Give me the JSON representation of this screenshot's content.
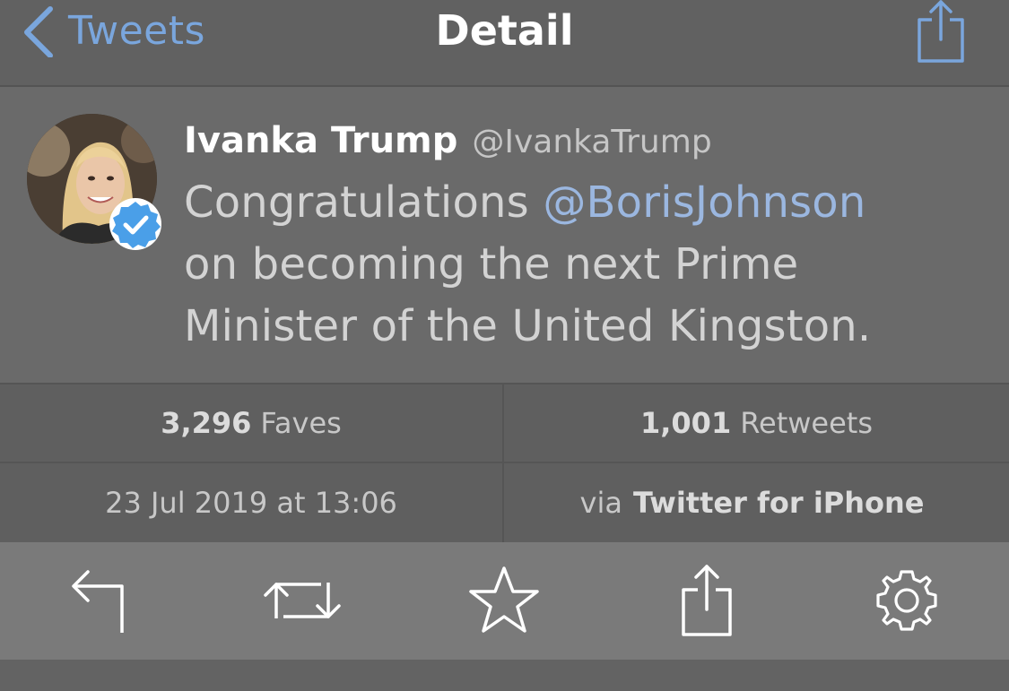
{
  "nav": {
    "back_label": "Tweets",
    "title": "Detail",
    "back_icon": "chevron-left-icon",
    "share_icon": "share-icon"
  },
  "tweet": {
    "author_name": "Ivanka Trump",
    "author_handle": "@IvankaTrump",
    "verified": true,
    "text_lines": [
      {
        "before": "Congratulations ",
        "mention": "@BorisJohnson"
      },
      {
        "text": "on becoming the next Prime"
      },
      {
        "text": "Minister of the United Kingston."
      }
    ]
  },
  "stats": {
    "faves_count": "3,296",
    "faves_label": "Faves",
    "retweets_count": "1,001",
    "retweets_label": "Retweets",
    "date": "23 Jul 2019 at 13:06",
    "via_prefix": "via",
    "via_source": "Twitter for iPhone"
  },
  "toolbar": {
    "icons": [
      "reply-icon",
      "retweet-icon",
      "star-icon",
      "share-icon",
      "gear-icon"
    ]
  },
  "colors": {
    "accent": "#7aa6dd",
    "mention": "#9bb7e0",
    "verified": "#4a9fe8",
    "background": "#5f5f5f"
  }
}
